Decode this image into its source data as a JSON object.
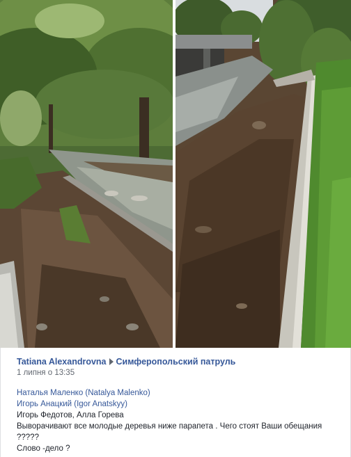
{
  "photos": [
    {
      "name": "left-photo",
      "description_icon": "photo-icon"
    },
    {
      "name": "right-photo",
      "description_icon": "photo-icon"
    }
  ],
  "post": {
    "author": "Tatiana Alexandrovna",
    "group": "Симферопольский патруль",
    "timestamp": "1 липня о 13:35",
    "mentions": [
      "Наталья Маленко (Natalya Malenko)",
      "Игорь Анацкий (Igor Anatskyy)",
      "Игорь Федотов, Алла Горева"
    ],
    "text_line1": "Выворачивают все молодые деревья ниже парапета . Чего стоят Ваши обещания",
    "text_line2": "?????",
    "text_line3": "Слово -дело ?"
  },
  "colors": {
    "link": "#365899",
    "text": "#1d2129",
    "meta": "#616770"
  }
}
